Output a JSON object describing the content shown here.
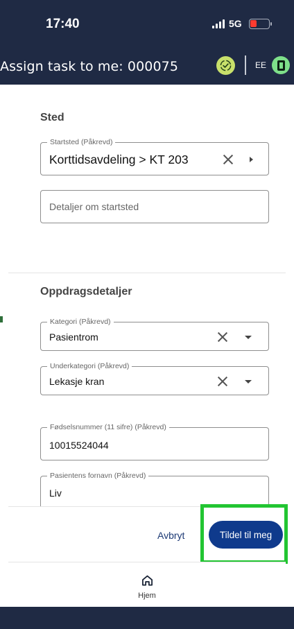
{
  "status_bar": {
    "time": "17:40",
    "network": "5G",
    "battery_icon": "battery-low-icon"
  },
  "header": {
    "title": "Assign task to me: 000075",
    "sync_icon": "sync-ok-icon",
    "user_initials": "EE",
    "device_icon": "phone-icon",
    "accent_colors": {
      "sync": "#c8e06b",
      "device": "#7ee08a",
      "bar": "#1f2a44"
    }
  },
  "location_section": {
    "title": "Sted",
    "start_location": {
      "label": "Startsted (Påkrevd)",
      "value": "Korttidsavdeling > KT 203"
    },
    "start_details": {
      "placeholder": "Detaljer om startsted"
    }
  },
  "task_section": {
    "title": "Oppdragsdetaljer",
    "category": {
      "label": "Kategori (Påkrevd)",
      "value": "Pasientrom"
    },
    "subcategory": {
      "label": "Underkategori (Påkrevd)",
      "value": "Lekasje kran"
    },
    "birth_number": {
      "label": "Fødselsnummer (11 sifre) (Påkrevd)",
      "value": "10015524044"
    },
    "first_name": {
      "label": "Pasientens fornavn (Påkrevd)",
      "value": "Liv"
    }
  },
  "actions": {
    "cancel_label": "Avbryt",
    "assign_label": "Tildel til meg",
    "primary_color": "#0f3a8c",
    "highlight_color": "#22c532"
  },
  "nav": {
    "home_label": "Hjem",
    "home_icon": "home-icon"
  }
}
